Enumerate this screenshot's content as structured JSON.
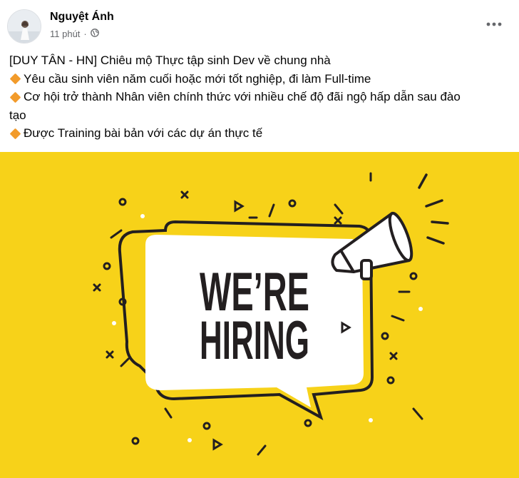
{
  "post": {
    "author": "Nguyệt Ánh",
    "time": "11 phút",
    "privacy_icon": "globe-icon",
    "more_icon": "more-horizontal-icon",
    "lines": [
      "[DUY TÂN - HN] Chiêu mộ Thực tập sinh Dev về chung nhà",
      "Yêu cầu sinh viên năm cuối hoặc mới tốt nghiệp, đi làm Full-time",
      "Cơ hội trở thành Nhân viên chính thức với nhiều chế độ đãi ngộ hấp dẫn sau đào",
      "tạo",
      "Được Training bài bản với các dự án thực tế"
    ],
    "bullet_icon": "orange-diamond-icon"
  },
  "image": {
    "headline_1": "WE’RE",
    "headline_2": "HIRING",
    "background_color": "#f7d219",
    "ink_color": "#231f20"
  }
}
